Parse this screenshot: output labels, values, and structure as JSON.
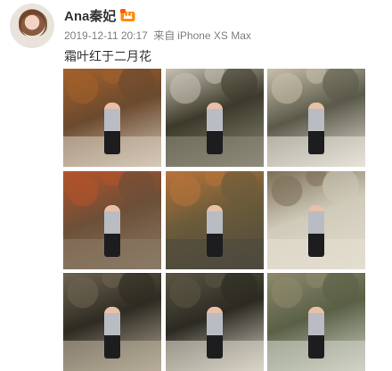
{
  "user": {
    "name": "Ana秦妃",
    "badge_icon": "vip-crown-icon"
  },
  "meta": {
    "time": "2019-12-11 20:17",
    "source_prefix": "来自",
    "source": "iPhone XS Max"
  },
  "post": {
    "text": "霜叶红于二月花"
  },
  "photos": {
    "colors": [
      [
        "#6b4a2e",
        "#a5612b",
        "#d4c8b8"
      ],
      [
        "#3c3a2a",
        "#c8c2b4",
        "#8d8a7a"
      ],
      [
        "#5b5a4a",
        "#c8c0ac",
        "#e7e2d8"
      ],
      [
        "#6c4f37",
        "#b5532a",
        "#8b7a66"
      ],
      [
        "#6a5b3a",
        "#b8743a",
        "#4d4a3d"
      ],
      [
        "#cfcab9",
        "#7c6e57",
        "#e3ddcf"
      ],
      [
        "#2f2b22",
        "#6e6452",
        "#b7ad99"
      ],
      [
        "#2c2a22",
        "#5b5645",
        "#d8d3c7"
      ],
      [
        "#5a6046",
        "#8e8a6d",
        "#cfd2c5"
      ]
    ]
  }
}
